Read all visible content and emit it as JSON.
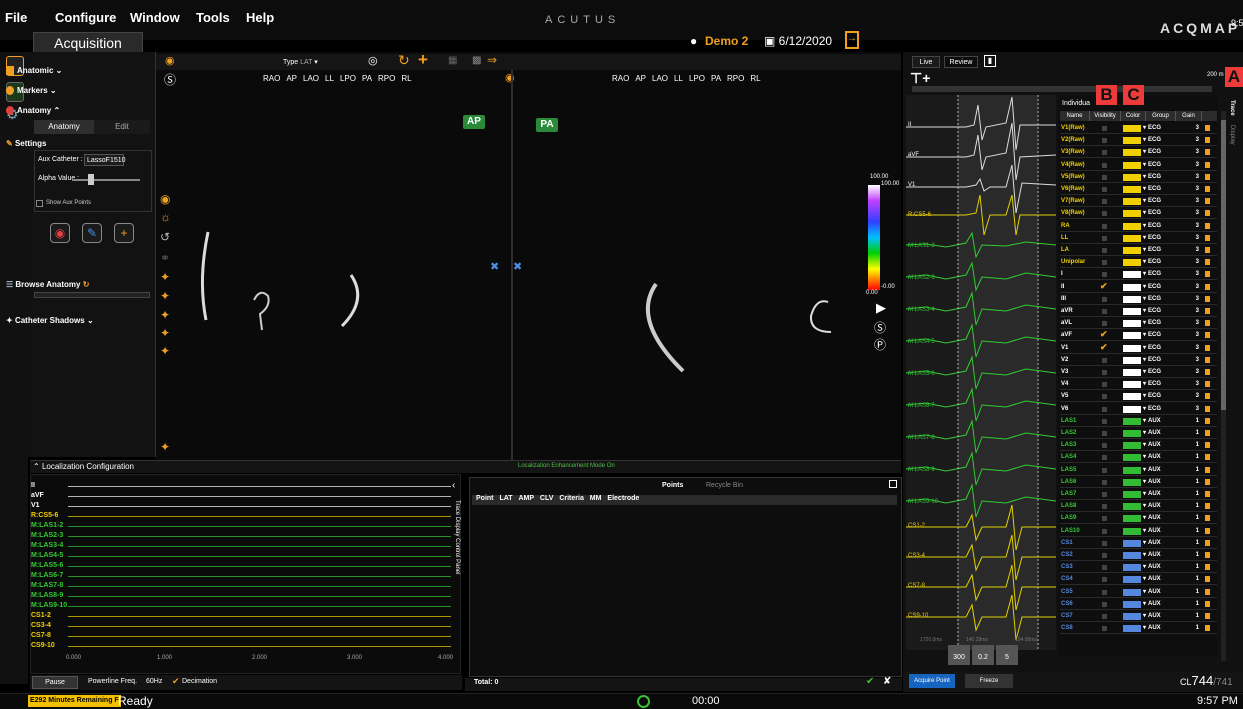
{
  "menu": {
    "items": [
      "File",
      "Configure",
      "Window",
      "Tools",
      "Help"
    ],
    "app_title": "ACUTUS",
    "logo": "ACQMAP",
    "clock_top": "9:57"
  },
  "header": {
    "tab": "Acquisition",
    "user": "Demo 2",
    "date": "6/12/2020"
  },
  "sidebar": {
    "sections": [
      {
        "label": "Anatomic"
      },
      {
        "label": "Markers"
      },
      {
        "label": "Anatomy"
      }
    ],
    "subtabs": [
      "Anatomy",
      "Edit"
    ],
    "settings_label": "Settings",
    "aux_catheter_label": "Aux Catheter :",
    "aux_catheter_value": "LassoF1510",
    "alpha_label": "Alpha Value :",
    "show_aux_points": "Show Aux Points",
    "browse_anatomy": "Browse Anatomy",
    "catheter_shadows": "Catheter Shadows"
  },
  "viewer": {
    "type_label": "Type",
    "type_value": "LAT",
    "views": [
      "RAO",
      "AP",
      "LAO",
      "LL",
      "LPO",
      "PA",
      "RPO",
      "RL"
    ],
    "tag_left": "AP",
    "tag_right": "PA",
    "colorbar_top": "100.00",
    "colorbar_top2": "100.00",
    "colorbar_bottom": "0.00",
    "colorbar_bottom2": "-0.00"
  },
  "localization": {
    "title": "Localization Configuration",
    "mode": "Localization Enhancement Mode On"
  },
  "trace_panel": {
    "labels": [
      {
        "text": "II",
        "color": "#ffffff"
      },
      {
        "text": "aVF",
        "color": "#ffffff"
      },
      {
        "text": "V1",
        "color": "#ffffff"
      },
      {
        "text": "R:CS5-6",
        "color": "#f0d000"
      },
      {
        "text": "M:LAS1-2",
        "color": "#33cc33"
      },
      {
        "text": "M:LAS2-3",
        "color": "#33cc33"
      },
      {
        "text": "M:LAS3-4",
        "color": "#33cc33"
      },
      {
        "text": "M:LAS4-5",
        "color": "#33cc33"
      },
      {
        "text": "M:LAS5-6",
        "color": "#33cc33"
      },
      {
        "text": "M:LAS6-7",
        "color": "#33cc33"
      },
      {
        "text": "M:LAS7-8",
        "color": "#33cc33"
      },
      {
        "text": "M:LAS8-9",
        "color": "#33cc33"
      },
      {
        "text": "M:LAS9-10",
        "color": "#33cc33"
      },
      {
        "text": "CS1-2",
        "color": "#f0d000"
      },
      {
        "text": "CS3-4",
        "color": "#f0d000"
      },
      {
        "text": "CS7-8",
        "color": "#f0d000"
      },
      {
        "text": "CS9-10",
        "color": "#f0d000"
      }
    ],
    "side_title": "Trace Display Control Panel",
    "axis": [
      "0.000",
      "1.000",
      "2.000",
      "3.000",
      "4.000"
    ],
    "pause": "Pause",
    "powerline": "Powerline Freq.",
    "freq": "60Hz",
    "decimation": "Decimation"
  },
  "points_panel": {
    "tabs": [
      "Points",
      "Recycle Bin"
    ],
    "columns": [
      "Point",
      "LAT",
      "AMP",
      "CLV",
      "Criteria",
      "MM",
      "Electrode"
    ],
    "total": "Total: 0"
  },
  "right_panel": {
    "tabs": [
      "Live",
      "Review"
    ],
    "scale": "200 m",
    "side_tabs": [
      "Trace",
      "Display"
    ],
    "table_title": "Individua",
    "columns": [
      "Name",
      "Visibility",
      "Color",
      "Group",
      "Gain"
    ],
    "wave_labels": [
      {
        "text": "II",
        "color": "#ffffff"
      },
      {
        "text": "aVF",
        "color": "#ffffff"
      },
      {
        "text": "V1",
        "color": "#ffffff"
      },
      {
        "text": "R:CS5-6",
        "color": "#f0d000"
      },
      {
        "text": "M:LAS1-2",
        "color": "#33cc33"
      },
      {
        "text": "M:LAS2-3",
        "color": "#33cc33"
      },
      {
        "text": "M:LAS3-4",
        "color": "#33cc33"
      },
      {
        "text": "M:LAS4-5",
        "color": "#33cc33"
      },
      {
        "text": "M:LAS5-6",
        "color": "#33cc33"
      },
      {
        "text": "M:LAS6-7",
        "color": "#33cc33"
      },
      {
        "text": "M:LAS7-8",
        "color": "#33cc33"
      },
      {
        "text": "M:LAS8-9",
        "color": "#33cc33"
      },
      {
        "text": "M:LAS9-10",
        "color": "#33cc33"
      },
      {
        "text": "CS1-2",
        "color": "#f0d000"
      },
      {
        "text": "CS3-4",
        "color": "#f0d000"
      },
      {
        "text": "CS7-8",
        "color": "#f0d000"
      },
      {
        "text": "CS9-10",
        "color": "#f0d000"
      }
    ],
    "time_labels": [
      "1720.0ms",
      "140.29ms",
      "194.00ms"
    ],
    "spinners": [
      "300",
      "0.2",
      "5"
    ],
    "rows": [
      {
        "name": "V1(Raw)",
        "ncolor": "#f0d000",
        "color": "#f0d000",
        "group": "ECG",
        "gain": "3",
        "checked": false
      },
      {
        "name": "V2(Raw)",
        "ncolor": "#f0d000",
        "color": "#f0d000",
        "group": "ECG",
        "gain": "3",
        "checked": false
      },
      {
        "name": "V3(Raw)",
        "ncolor": "#f0d000",
        "color": "#f0d000",
        "group": "ECG",
        "gain": "3",
        "checked": false
      },
      {
        "name": "V4(Raw)",
        "ncolor": "#f0d000",
        "color": "#f0d000",
        "group": "ECG",
        "gain": "3",
        "checked": false
      },
      {
        "name": "V5(Raw)",
        "ncolor": "#f0d000",
        "color": "#f0d000",
        "group": "ECG",
        "gain": "3",
        "checked": false
      },
      {
        "name": "V6(Raw)",
        "ncolor": "#f0d000",
        "color": "#f0d000",
        "group": "ECG",
        "gain": "3",
        "checked": false
      },
      {
        "name": "V7(Raw)",
        "ncolor": "#f0d000",
        "color": "#f0d000",
        "group": "ECG",
        "gain": "3",
        "checked": false
      },
      {
        "name": "V8(Raw)",
        "ncolor": "#f0d000",
        "color": "#f0d000",
        "group": "ECG",
        "gain": "3",
        "checked": false
      },
      {
        "name": "RA",
        "ncolor": "#f0d000",
        "color": "#f0d000",
        "group": "ECG",
        "gain": "3",
        "checked": false
      },
      {
        "name": "LL",
        "ncolor": "#f0d000",
        "color": "#f0d000",
        "group": "ECG",
        "gain": "3",
        "checked": false
      },
      {
        "name": "LA",
        "ncolor": "#f0d000",
        "color": "#f0d000",
        "group": "ECG",
        "gain": "3",
        "checked": false
      },
      {
        "name": "Unipolar",
        "ncolor": "#f0d000",
        "color": "#f0d000",
        "group": "ECG",
        "gain": "3",
        "checked": false
      },
      {
        "name": "I",
        "ncolor": "#ffffff",
        "color": "#ffffff",
        "group": "ECG",
        "gain": "3",
        "checked": false
      },
      {
        "name": "II",
        "ncolor": "#ffffff",
        "color": "#ffffff",
        "group": "ECG",
        "gain": "3",
        "checked": true
      },
      {
        "name": "III",
        "ncolor": "#ffffff",
        "color": "#ffffff",
        "group": "ECG",
        "gain": "3",
        "checked": false
      },
      {
        "name": "aVR",
        "ncolor": "#ffffff",
        "color": "#ffffff",
        "group": "ECG",
        "gain": "3",
        "checked": false
      },
      {
        "name": "aVL",
        "ncolor": "#ffffff",
        "color": "#ffffff",
        "group": "ECG",
        "gain": "3",
        "checked": false
      },
      {
        "name": "aVF",
        "ncolor": "#ffffff",
        "color": "#ffffff",
        "group": "ECG",
        "gain": "3",
        "checked": true
      },
      {
        "name": "V1",
        "ncolor": "#ffffff",
        "color": "#ffffff",
        "group": "ECG",
        "gain": "3",
        "checked": true
      },
      {
        "name": "V2",
        "ncolor": "#ffffff",
        "color": "#ffffff",
        "group": "ECG",
        "gain": "3",
        "checked": false
      },
      {
        "name": "V3",
        "ncolor": "#ffffff",
        "color": "#ffffff",
        "group": "ECG",
        "gain": "3",
        "checked": false
      },
      {
        "name": "V4",
        "ncolor": "#ffffff",
        "color": "#ffffff",
        "group": "ECG",
        "gain": "3",
        "checked": false
      },
      {
        "name": "V5",
        "ncolor": "#ffffff",
        "color": "#ffffff",
        "group": "ECG",
        "gain": "3",
        "checked": false
      },
      {
        "name": "V6",
        "ncolor": "#ffffff",
        "color": "#ffffff",
        "group": "ECG",
        "gain": "3",
        "checked": false
      },
      {
        "name": "LAS1",
        "ncolor": "#33cc33",
        "color": "#33bb33",
        "group": "AUX",
        "gain": "1",
        "checked": false
      },
      {
        "name": "LAS2",
        "ncolor": "#33cc33",
        "color": "#33bb33",
        "group": "AUX",
        "gain": "1",
        "checked": false
      },
      {
        "name": "LAS3",
        "ncolor": "#33cc33",
        "color": "#33bb33",
        "group": "AUX",
        "gain": "1",
        "checked": false
      },
      {
        "name": "LAS4",
        "ncolor": "#33cc33",
        "color": "#33bb33",
        "group": "AUX",
        "gain": "1",
        "checked": false
      },
      {
        "name": "LAS5",
        "ncolor": "#33cc33",
        "color": "#33bb33",
        "group": "AUX",
        "gain": "1",
        "checked": false
      },
      {
        "name": "LAS6",
        "ncolor": "#33cc33",
        "color": "#33bb33",
        "group": "AUX",
        "gain": "1",
        "checked": false
      },
      {
        "name": "LAS7",
        "ncolor": "#33cc33",
        "color": "#33bb33",
        "group": "AUX",
        "gain": "1",
        "checked": false
      },
      {
        "name": "LAS8",
        "ncolor": "#33cc33",
        "color": "#33bb33",
        "group": "AUX",
        "gain": "1",
        "checked": false
      },
      {
        "name": "LAS9",
        "ncolor": "#33cc33",
        "color": "#33bb33",
        "group": "AUX",
        "gain": "1",
        "checked": false
      },
      {
        "name": "LAS10",
        "ncolor": "#33cc33",
        "color": "#33bb33",
        "group": "AUX",
        "gain": "1",
        "checked": false
      },
      {
        "name": "CS1",
        "ncolor": "#5588dd",
        "color": "#5588dd",
        "group": "AUX",
        "gain": "1",
        "checked": false
      },
      {
        "name": "CS2",
        "ncolor": "#5588dd",
        "color": "#5588dd",
        "group": "AUX",
        "gain": "1",
        "checked": false
      },
      {
        "name": "CS3",
        "ncolor": "#5588dd",
        "color": "#5588dd",
        "group": "AUX",
        "gain": "1",
        "checked": false
      },
      {
        "name": "CS4",
        "ncolor": "#5588dd",
        "color": "#5588dd",
        "group": "AUX",
        "gain": "1",
        "checked": false
      },
      {
        "name": "CS5",
        "ncolor": "#5588dd",
        "color": "#5588dd",
        "group": "AUX",
        "gain": "1",
        "checked": false
      },
      {
        "name": "CS6",
        "ncolor": "#5588dd",
        "color": "#5588dd",
        "group": "AUX",
        "gain": "1",
        "checked": false
      },
      {
        "name": "CS7",
        "ncolor": "#5588dd",
        "color": "#5588dd",
        "group": "AUX",
        "gain": "1",
        "checked": false
      },
      {
        "name": "CS8",
        "ncolor": "#5588dd",
        "color": "#5588dd",
        "group": "AUX",
        "gain": "1",
        "checked": false
      }
    ],
    "acquire": "Acquire Point",
    "freeze": "Freeze",
    "cl_prefix": "CL",
    "cl_value": "744",
    "cl_suffix": "/741"
  },
  "annotations": [
    "B",
    "C",
    "A"
  ],
  "status": {
    "minutes": "E292 Minutes Remaining F",
    "ready": "Ready",
    "timer": "00:00",
    "clock": "9:57 PM"
  }
}
